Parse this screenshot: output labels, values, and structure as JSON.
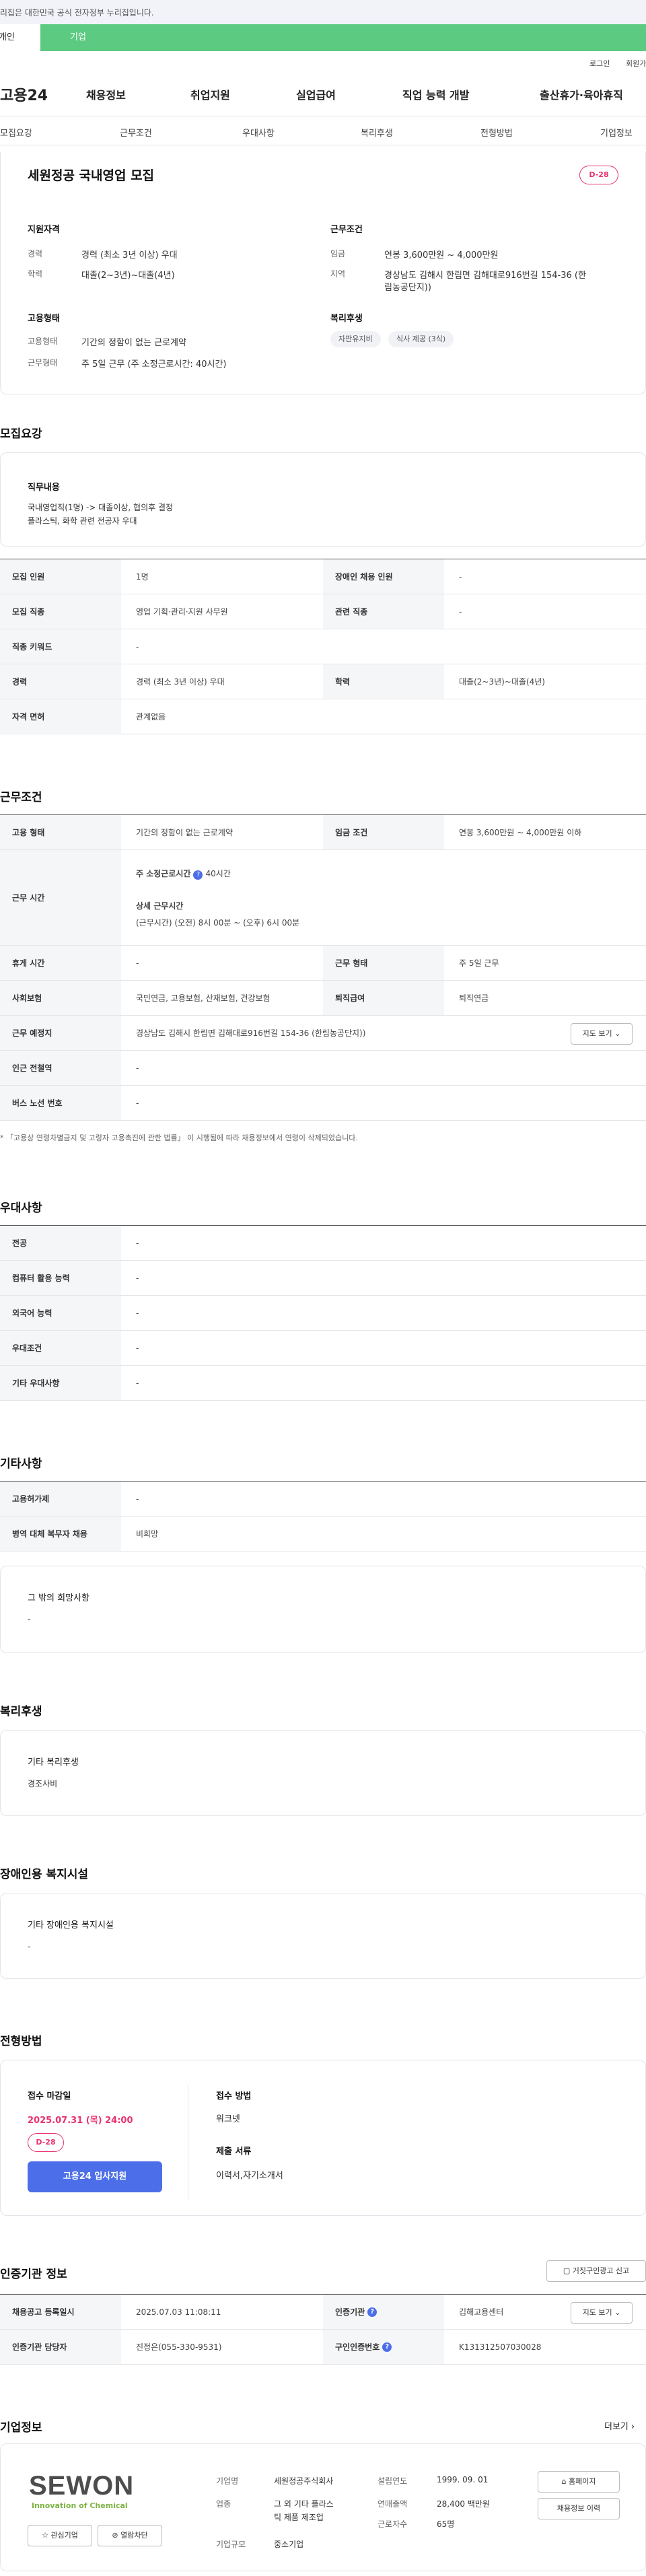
{
  "gov_notice": "이 누리집은 대한민국 공식 전자정부 누리집입니다.",
  "usertype": {
    "personal": "개인",
    "company": "기업"
  },
  "util": {
    "login": "로그인",
    "join": "회원가입"
  },
  "gnb": {
    "logo": "고용24",
    "menu": [
      "채용정보",
      "취업지원",
      "실업급여",
      "직업 능력 개발",
      "출산휴가·육아휴직"
    ]
  },
  "tabs": [
    "모집요강",
    "근무조건",
    "우대사항",
    "복리후생",
    "전형방법",
    "기업정보"
  ],
  "summary": {
    "title": "세원정공 국내영업 모집",
    "dday": "D-28",
    "qual_title": "지원자격",
    "career_label": "경력",
    "career_value": "경력 (최소 3년 이상) 우대",
    "edu_label": "학력",
    "edu_value": "대졸(2~3년)~대졸(4년)",
    "cond_title": "근무조건",
    "wage_label": "임금",
    "wage_value": "연봉 3,600만원 ~ 4,000만원",
    "region_label": "지역",
    "region_value_1": "경상남도 김해시 한림면 김해대로916번길 154-36 (한",
    "region_value_2": "림농공단지))",
    "emp_title": "고용형태",
    "emptype_label": "고용형태",
    "emptype_value": "기간의 정함이 없는 근로계약",
    "worktype_label": "근무형태",
    "worktype_value": "주 5일 근무 (주 소정근로시간: 40시간)",
    "welfare_title": "복리후생",
    "welfare_chips": [
      "자판유지비",
      "식사 제공 (3식)"
    ]
  },
  "recruit": {
    "section_title": "모집요강",
    "duty_title": "직무내용",
    "duty_line1": "국내영업직(1명) -> 대졸이상, 협의후 결정",
    "duty_line2": "플라스틱, 화학 관련 전공자 우대",
    "rows": {
      "count_label": "모집 인원",
      "count_value": "1명",
      "disabled_label": "장애인 채용 인원",
      "disabled_value": "-",
      "job_label": "모집 직종",
      "job_value": "영업 기획·관리·지원 사무원",
      "related_label": "관련 직종",
      "related_value": "-",
      "keyword_label": "직종 키워드",
      "keyword_value": "-",
      "career_label": "경력",
      "career_value": "경력 (최소 3년 이상) 우대",
      "edu_label": "학력",
      "edu_value": "대졸(2~3년)~대졸(4년)",
      "license_label": "자격 면허",
      "license_value": "관계없음"
    }
  },
  "condition": {
    "section_title": "근무조건",
    "emptype_label": "고용 형태",
    "emptype_value": "기간의 정함이 없는 근로계약",
    "wage_label": "임금 조건",
    "wage_value": "연봉 3,600만원 ~ 4,000만원 이하",
    "hours_label": "근무 시간",
    "hours_sub1": "주 소정근로시간",
    "hours_value1": "40시간",
    "hours_sub2": "상세 근무시간",
    "hours_value2": "(근무시간) (오전) 8시 00분 ~ (오후) 6시 00분",
    "rest_label": "휴게 시간",
    "rest_value": "-",
    "worktype_label": "근무 형태",
    "worktype_value": "주 5일 근무",
    "insurance_label": "사회보험",
    "insurance_value": "국민연금, 고용보험, 산재보험, 건강보험",
    "retire_label": "퇴직급여",
    "retire_value": "퇴직연금",
    "place_label": "근무 예정지",
    "place_value": "경상남도 김해시 한림면 김해대로916번길 154-36 (한림농공단지))",
    "map_btn": "지도 보기",
    "station_label": "인근 전철역",
    "station_value": "-",
    "bus_label": "버스 노선 번호",
    "bus_value": "-",
    "note": "* 「고용상 연령차별금지 및 고령자 고용촉진에 관한 법률」 이 시행됨에 따라 채용정보에서 연령이 삭제되었습니다."
  },
  "prefer": {
    "section_title": "우대사항",
    "rows": [
      {
        "label": "전공",
        "value": "-"
      },
      {
        "label": "컴퓨터 활용 능력",
        "value": "-"
      },
      {
        "label": "외국어 능력",
        "value": "-"
      },
      {
        "label": "우대조건",
        "value": "-"
      },
      {
        "label": "기타 우대사항",
        "value": "-"
      }
    ]
  },
  "etc": {
    "section_title": "기타사항",
    "rows": [
      {
        "label": "고용허가제",
        "value": "-"
      },
      {
        "label": "병역 대체 복무자 채용",
        "value": "비희망"
      }
    ],
    "card_title": "그 밖의 희망사항",
    "card_value": "-"
  },
  "welfare": {
    "section_title": "복리후생",
    "card_title": "기타 복리후생",
    "card_value": "경조사비"
  },
  "disabled": {
    "section_title": "장애인용 복지시설",
    "card_title": "기타 장애인용 복지시설",
    "card_value": "-"
  },
  "process": {
    "section_title": "전형방법",
    "deadline_label": "접수 마감일",
    "deadline_value": "2025.07.31 (목) 24:00",
    "dday": "D-28",
    "apply_btn": "고용24 입사지원",
    "method_label": "접수 방법",
    "method_value": "워크넷",
    "docs_label": "제출 서류",
    "docs_value": "이력서,자기소개서"
  },
  "cert": {
    "section_title": "인증기관 정보",
    "report_btn": "거짓구인광고 신고",
    "reg_label": "채용공고 등록일시",
    "reg_value": "2025.07.03 11:08:11",
    "agency_label": "인증기관",
    "agency_value": "김해고용센터",
    "map_btn": "지도 보기",
    "staff_label": "인증기관 담당자",
    "staff_value": "진정은(055-330-9531)",
    "num_label": "구인인증번호",
    "num_value": "K131312507030028"
  },
  "company": {
    "section_title": "기업정보",
    "more": "더보기",
    "logo_text": "SEWON",
    "logo_tag": "Innovation of Chemical",
    "fav_btn": "관심기업",
    "block_btn": "열람차단",
    "name_label": "기업명",
    "name_value": "세원정공주식회사",
    "industry_label": "업종",
    "industry_value_1": "그 외 기타 플라스",
    "industry_value_2": "틱 제품 제조업",
    "size_label": "기업규모",
    "size_value": "중소기업",
    "year_label": "설립연도",
    "year_value": "1999. 09. 01",
    "sales_label": "연매출액",
    "sales_value": "28,400 백만원",
    "emp_label": "근로자수",
    "emp_value": "65명",
    "home_btn": "홈페이지",
    "recruit_btn": "채용정보 이력"
  },
  "colors": {
    "accent": "#4c6ee8",
    "green": "#5ccb81",
    "pink": "#e8336d"
  }
}
